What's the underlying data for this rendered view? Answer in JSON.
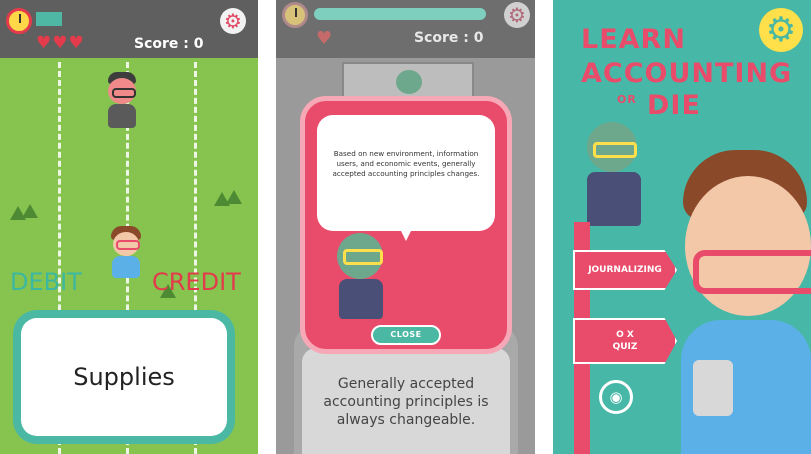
{
  "screen1": {
    "score_label": "Score : 0",
    "hearts": "♥♥♥",
    "debit_label": "DEBIT",
    "credit_label": "CREDIT",
    "card_text": "Supplies",
    "timer_icon": "stopwatch-icon",
    "settings_icon": "gear-icon"
  },
  "screen2": {
    "score_label": "Score : 0",
    "hearts": "♥",
    "bubble_text": "Based on new environment, information users, and economic events, generally accepted accounting principles changes.",
    "close_label": "CLOSE",
    "card_text": "Generally accepted accounting principles is always changeable.",
    "settings_icon": "gear-icon"
  },
  "screen3": {
    "title_line1": "LEARN",
    "title_line2": "ACCOUNTING",
    "title_or": "OR",
    "title_line3": "DIE",
    "menu_journalizing": "JOURNALIZING",
    "menu_ox": "O X",
    "menu_quiz": "QUIZ",
    "settings_icon": "gear-icon",
    "camera_icon": "camera-icon"
  },
  "colors": {
    "field_green": "#86c44f",
    "teal": "#4bb8a4",
    "red": "#e84c6a",
    "dark_bar": "#5f5f5f"
  }
}
